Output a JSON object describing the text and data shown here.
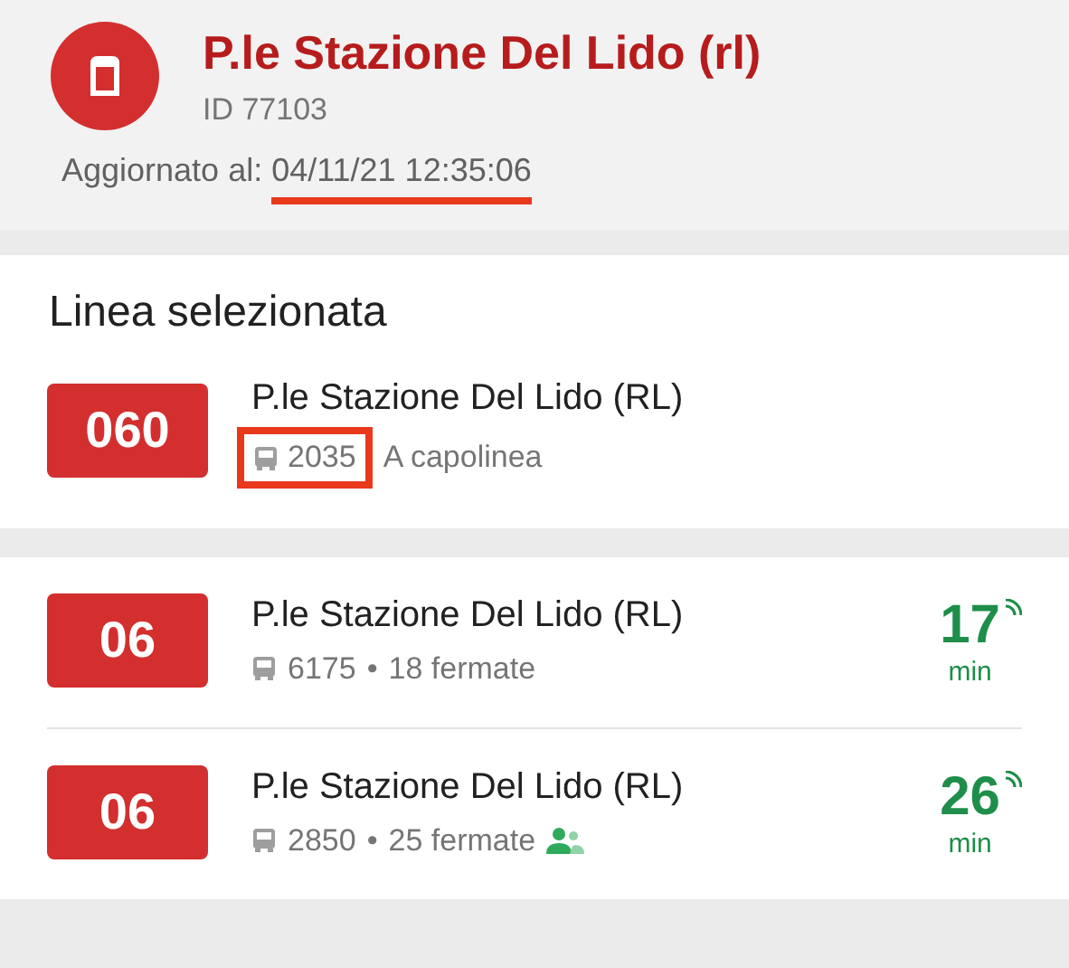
{
  "stop": {
    "name": "P.le Stazione Del Lido (rl)",
    "id": "ID 77103",
    "updated_label": "Aggiornato al:",
    "updated_value": "04/11/21 12:35:06",
    "updated_highlighted": true
  },
  "selected_line": {
    "title": "Linea selezionata",
    "line": "060",
    "destination": "P.le Stazione Del Lido (RL)",
    "vehicle": "2035",
    "vehicle_highlighted": true,
    "status": "A capolinea"
  },
  "departures": [
    {
      "line": "06",
      "destination": "P.le Stazione Del Lido (RL)",
      "vehicle": "6175",
      "separator": "•",
      "stops": "18 fermate",
      "minutes": "17",
      "unit": "min",
      "realtime": true,
      "crowding": false
    },
    {
      "line": "06",
      "destination": "P.le Stazione Del Lido (RL)",
      "vehicle": "2850",
      "separator": "•",
      "stops": "25 fermate",
      "minutes": "26",
      "unit": "min",
      "realtime": true,
      "crowding": true
    }
  ]
}
